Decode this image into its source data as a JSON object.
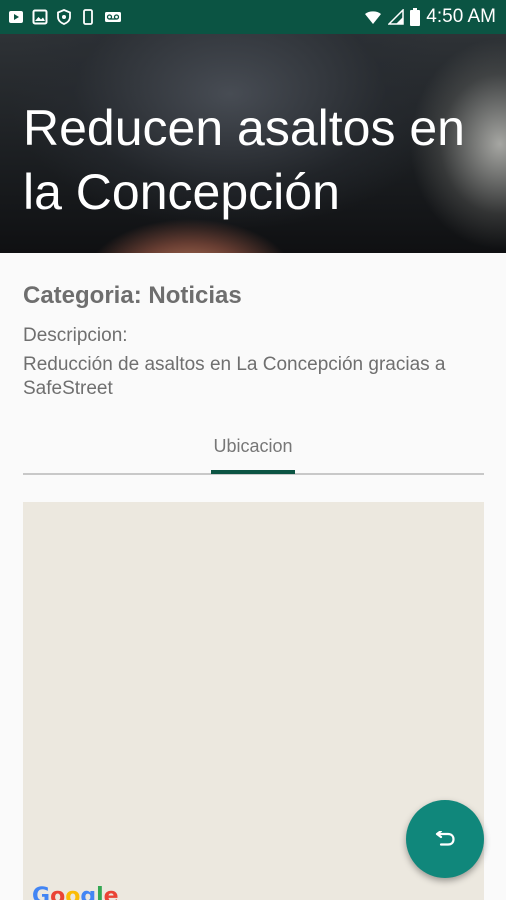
{
  "status_bar": {
    "time": "4:50 AM",
    "left_icons": [
      "play-store-notification-icon",
      "image-notification-icon",
      "shield-notification-icon",
      "phone-notification-icon",
      "voicemail-notification-icon"
    ],
    "right_icons": [
      "wifi-icon",
      "cell-signal-icon",
      "battery-icon"
    ],
    "background": "#0b5443"
  },
  "header": {
    "title": "Reducen asaltos en la Concepción"
  },
  "content": {
    "category": "Categoria: Noticias",
    "description_label": "Descripcion:",
    "description_text": "Reducción de asaltos en La Concepción gracias a SafeStreet"
  },
  "tabs": [
    {
      "label": "Ubicacion",
      "selected": true
    }
  ],
  "map": {
    "attribution": [
      "G",
      "o",
      "o",
      "g",
      "l",
      "e"
    ],
    "attribution_colors": [
      "#4285F4",
      "#EA4335",
      "#FBBC05",
      "#4285F4",
      "#34A853",
      "#EA4335"
    ],
    "background": "#ece8df"
  },
  "fab": {
    "icon": "undo-return-icon",
    "color": "#10877b"
  }
}
